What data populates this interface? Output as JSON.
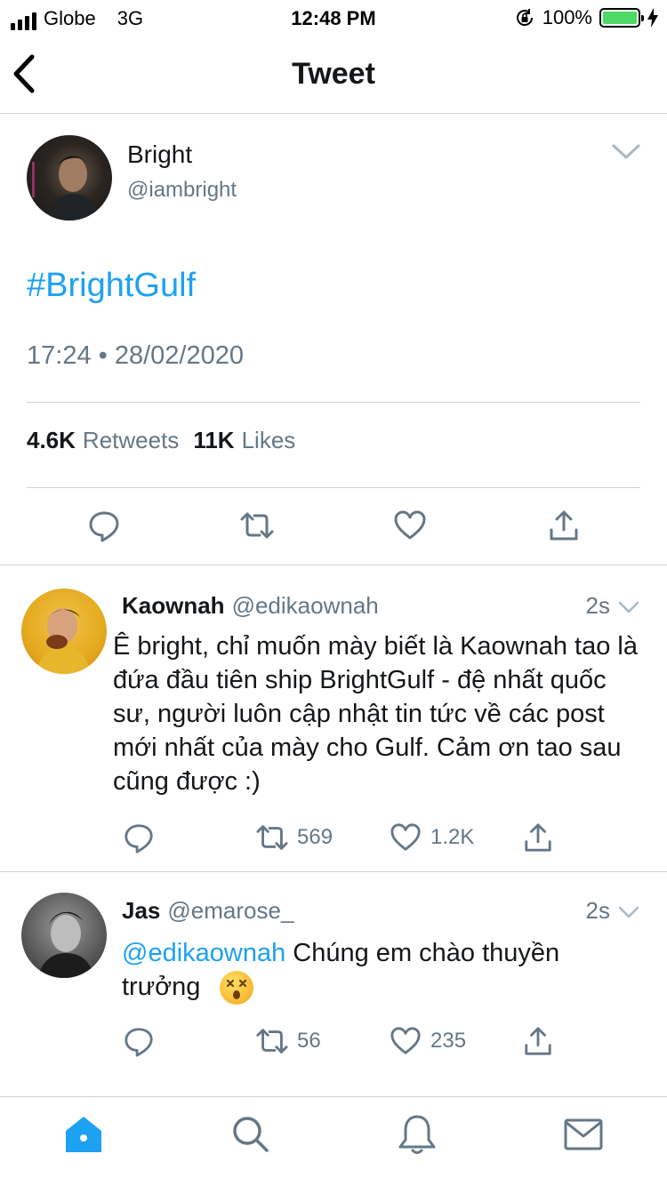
{
  "status_bar": {
    "carrier": "Globe",
    "network": "3G",
    "time": "12:48 PM",
    "battery": "100%"
  },
  "nav": {
    "title": "Tweet"
  },
  "tweet": {
    "name": "Bright",
    "handle": "@iambright",
    "text": "#BrightGulf",
    "timestamp": "17:24 • 28/02/2020",
    "retweets_count": "4.6K",
    "retweets_label": "Retweets",
    "likes_count": "11K",
    "likes_label": "Likes"
  },
  "replies": [
    {
      "name": "Kaownah",
      "handle": "@edikaownah",
      "time": "2s",
      "text": "Ê bright, chỉ muốn mày biết là Kaownah tao là đứa đầu tiên ship BrightGulf - đệ nhất quốc sư, người luôn cập nhật tin tức về các post mới nhất của mày cho Gulf. Cảm ơn tao sau cũng được :)",
      "retweets": "569",
      "likes": "1.2K"
    },
    {
      "name": "Jas",
      "handle": "@emarose_",
      "time": "2s",
      "mention": "@edikaownah",
      "text": "Chúng em chào thuyền trưởng",
      "emoji": "dizzy-face-emoji",
      "retweets": "56",
      "likes": "235"
    }
  ],
  "colors": {
    "accent": "#1da1f2",
    "secondary_text": "#657786",
    "divider": "#ccd6dd",
    "battery": "#4cd964"
  },
  "icons": [
    "back-chevron-icon",
    "chevron-down-icon",
    "reply-icon",
    "retweet-icon",
    "like-icon",
    "share-icon",
    "home-icon",
    "search-icon",
    "notifications-icon",
    "messages-icon"
  ]
}
